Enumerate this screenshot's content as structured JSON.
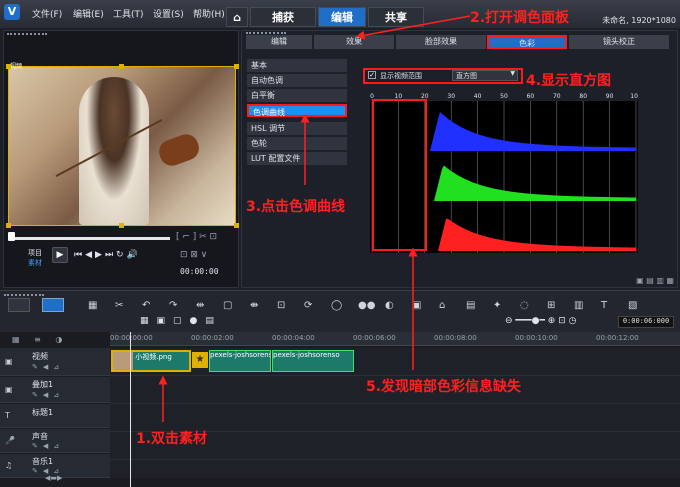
{
  "menu": [
    "文件(F)",
    "编辑(E)",
    "工具(T)",
    "设置(S)",
    "帮助(H)"
  ],
  "tabs": {
    "capture": "捕获",
    "edit": "编辑",
    "share": "共享"
  },
  "project_info": "未命名, 1920*1080",
  "annotations": {
    "a1": "1.双击素材",
    "a2": "2.打开调色面板",
    "a3": "3.点击色调曲线",
    "a4": "4.显示直方图",
    "a5": "5.发现暗部色彩信息缺失"
  },
  "panel_tabs": [
    "编辑",
    "效果",
    "脸部效果",
    "色彩",
    "镜头校正"
  ],
  "color_list": [
    "基本",
    "自动色调",
    "白平衡",
    "色调曲线",
    "HSL 调节",
    "色轮",
    "LUT 配置文件"
  ],
  "histogram": {
    "checkbox_label": "显示视频范围",
    "mode": "直方图",
    "ticks": [
      "0",
      "10",
      "20",
      "30",
      "40",
      "50",
      "60",
      "70",
      "80",
      "90",
      "100"
    ]
  },
  "preview": {
    "clip_label": "视频",
    "mode_project": "项目",
    "mode_clip": "素材",
    "timecode": "00:00:00"
  },
  "timeline": {
    "ruler": [
      "00:00:00:00",
      "00:00:02:00",
      "00:00:04:00",
      "00:00:06:00",
      "00:00:08:00",
      "00:00:10:00",
      "00:00:12:00"
    ],
    "zoom_time": "0:00:06:000",
    "tracks": [
      "视频",
      "叠加1",
      "标题1",
      "声音",
      "音乐1"
    ],
    "clips": [
      "小视频.png",
      "pexels-joshsorenso",
      "pexels-joshsorenso"
    ]
  },
  "colors": {
    "accent": "#1f6fc9",
    "annotation": "#ff2020"
  }
}
